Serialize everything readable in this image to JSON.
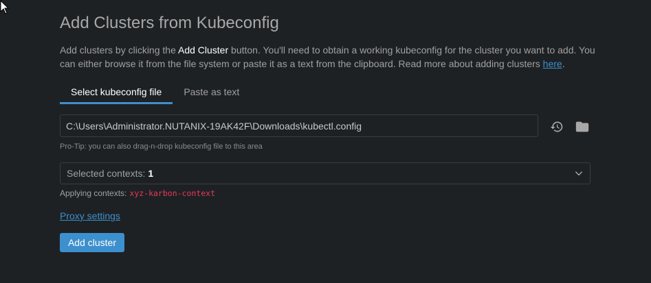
{
  "title": "Add Clusters from Kubeconfig",
  "description": {
    "part1": "Add clusters by clicking the ",
    "bold": "Add Cluster",
    "part2": " button. You'll need to obtain a working kubeconfig for the cluster you want to add. You can either browse it from the file system or paste it as a text from the clipboard. Read more about adding clusters ",
    "link": "here",
    "part3": "."
  },
  "tabs": [
    {
      "label": "Select kubeconfig file",
      "active": true
    },
    {
      "label": "Paste as text",
      "active": false
    }
  ],
  "file_path": {
    "value": "C:\\Users\\Administrator.NUTANIX-19AK42F\\Downloads\\kubectl.config"
  },
  "hint": "Pro-Tip: you can also drag-n-drop kubeconfig file to this area",
  "contexts_select": {
    "label": "Selected contexts:",
    "count": "1"
  },
  "applying": {
    "label": "Applying contexts:",
    "context": "xyz-karbon-context"
  },
  "proxy_link": "Proxy settings",
  "add_button": "Add cluster",
  "icons": {
    "reload": "reload-icon",
    "folder": "folder-icon",
    "chevron": "chevron-down-icon",
    "cursor": "mouse-cursor-icon"
  },
  "colors": {
    "background": "#1e2124",
    "accent": "#3d90ce",
    "context_code": "#e8395a"
  }
}
